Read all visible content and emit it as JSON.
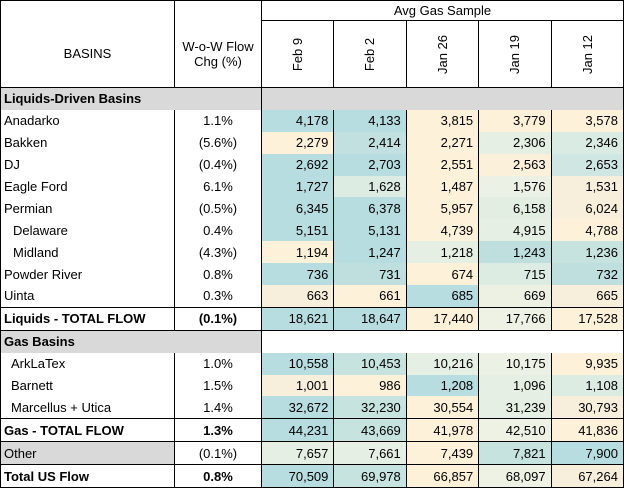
{
  "header": {
    "group_label": "Avg Gas Sample",
    "basins_label": "BASINS",
    "chg_label_line1": "W-o-W Flow",
    "chg_label_line2": "Chg (%)",
    "dates": [
      "Feb 9",
      "Feb 2",
      "Jan 26",
      "Jan 19",
      "Jan 12"
    ]
  },
  "colors": {
    "teal": "#b7dde0",
    "mint": "#e6f0e6",
    "cream": "#fdf1d9",
    "light": "#edf2e6",
    "section": "#d9d9d9"
  },
  "sections": {
    "liquids": "Liquids-Driven Basins",
    "gas": "Gas Basins"
  },
  "rows": [
    {
      "name": "Anadarko",
      "chg": "1.1%",
      "vals": [
        "4,178",
        "4,133",
        "3,815",
        "3,779",
        "3,578"
      ],
      "colors": [
        "#b7dde0",
        "#b7dde0",
        "#fdf1d9",
        "#fdf1d9",
        "#fdf1d9"
      ]
    },
    {
      "name": "Bakken",
      "chg": "(5.6%)",
      "vals": [
        "2,279",
        "2,414",
        "2,271",
        "2,306",
        "2,346"
      ],
      "colors": [
        "#fdf1d9",
        "#c2e0df",
        "#fdf1d9",
        "#e6efe3",
        "#d9ebe2"
      ]
    },
    {
      "name": "DJ",
      "chg": "(0.4%)",
      "vals": [
        "2,692",
        "2,703",
        "2,551",
        "2,563",
        "2,653"
      ],
      "colors": [
        "#b7dde0",
        "#b7dde0",
        "#fdf1d9",
        "#fbf0da",
        "#cfe6e2"
      ]
    },
    {
      "name": "Eagle Ford",
      "chg": "6.1%",
      "vals": [
        "1,727",
        "1,628",
        "1,487",
        "1,576",
        "1,531"
      ],
      "colors": [
        "#b7dde0",
        "#dcece2",
        "#fdf1d9",
        "#ebf1e4",
        "#f7efdb"
      ]
    },
    {
      "name": "Permian",
      "chg": "(0.5%)",
      "vals": [
        "6,345",
        "6,378",
        "5,957",
        "6,158",
        "6,024"
      ],
      "colors": [
        "#b7dde0",
        "#b7dde0",
        "#fdf1d9",
        "#e3eee3",
        "#f7efdb"
      ]
    },
    {
      "name": "Delaware",
      "chg": "0.4%",
      "vals": [
        "5,151",
        "5,131",
        "4,739",
        "4,915",
        "4,788"
      ],
      "colors": [
        "#b7dde0",
        "#b7dde0",
        "#fdf1d9",
        "#e6efe3",
        "#fdf1d9"
      ],
      "indent": true
    },
    {
      "name": "Midland",
      "chg": "(4.3%)",
      "vals": [
        "1,194",
        "1,247",
        "1,218",
        "1,243",
        "1,236"
      ],
      "colors": [
        "#fdf1d9",
        "#b7dde0",
        "#e6efe3",
        "#bfdfdf",
        "#c7e3e0"
      ],
      "indent": true
    },
    {
      "name": "Powder River",
      "chg": "0.8%",
      "vals": [
        "736",
        "731",
        "674",
        "715",
        "732"
      ],
      "colors": [
        "#b7dde0",
        "#bfdfdf",
        "#fdf1d9",
        "#dcece2",
        "#bfdfdf"
      ]
    },
    {
      "name": "Uinta",
      "chg": "0.3%",
      "vals": [
        "663",
        "661",
        "685",
        "669",
        "665"
      ],
      "colors": [
        "#f7efdb",
        "#fdf1d9",
        "#b7dde0",
        "#edf1e4",
        "#f7efdb"
      ]
    },
    {
      "name": "Liquids - TOTAL FLOW",
      "chg": "(0.1%)",
      "vals": [
        "18,621",
        "18,647",
        "17,440",
        "17,766",
        "17,528"
      ],
      "colors": [
        "#b7dde0",
        "#b7dde0",
        "#fdf1d9",
        "#eef2e4",
        "#fdf1d9"
      ],
      "total": true
    },
    {
      "section": "gas"
    },
    {
      "name": "ArkLaTex",
      "chg": "1.0%",
      "vals": [
        "10,558",
        "10,453",
        "10,216",
        "10,175",
        "9,935"
      ],
      "colors": [
        "#b7dde0",
        "#c7e3e0",
        "#e6efe3",
        "#ebf1e4",
        "#fdf1d9"
      ],
      "indent_small": true
    },
    {
      "name": "Barnett",
      "chg": "1.5%",
      "vals": [
        "1,001",
        "986",
        "1,208",
        "1,096",
        "1,108"
      ],
      "colors": [
        "#f7efdb",
        "#fdf1d9",
        "#b7dde0",
        "#e6efe3",
        "#dcece2"
      ],
      "indent_small": true
    },
    {
      "name": "Marcellus + Utica",
      "chg": "1.4%",
      "vals": [
        "32,672",
        "32,230",
        "30,554",
        "31,239",
        "30,793"
      ],
      "colors": [
        "#b7dde0",
        "#c7e3e0",
        "#fdf1d9",
        "#e6efe3",
        "#f7efdb"
      ],
      "indent_small": true
    },
    {
      "name": "Gas - TOTAL FLOW",
      "chg": "1.3%",
      "vals": [
        "44,231",
        "43,669",
        "41,978",
        "42,510",
        "41,836"
      ],
      "colors": [
        "#b7dde0",
        "#c7e3e0",
        "#fdf1d9",
        "#eef2e4",
        "#fdf1d9"
      ],
      "total": true
    },
    {
      "name": "Other",
      "chg": "(0.1%)",
      "vals": [
        "7,657",
        "7,661",
        "7,439",
        "7,821",
        "7,900"
      ],
      "colors": [
        "#e6efe3",
        "#e6efe3",
        "#fdf1d9",
        "#c7e3e0",
        "#b7dde0"
      ],
      "other": true
    },
    {
      "name": "Total US Flow",
      "chg": "0.8%",
      "vals": [
        "70,509",
        "69,978",
        "66,857",
        "68,097",
        "67,264"
      ],
      "colors": [
        "#b7dde0",
        "#c7e3e0",
        "#fdf1d9",
        "#eef2e4",
        "#f7efdb"
      ],
      "total": true
    }
  ]
}
